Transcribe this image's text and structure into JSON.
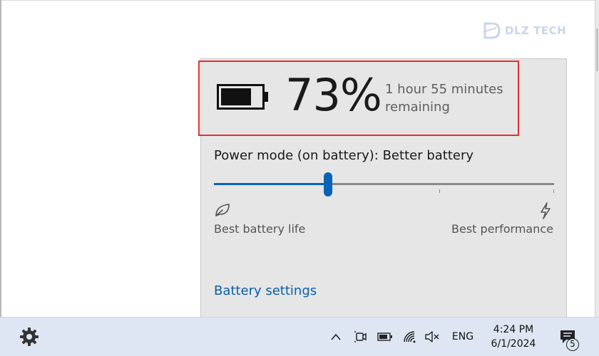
{
  "watermark": {
    "text": "DLZ TECH"
  },
  "battery_flyout": {
    "percent": "73%",
    "remaining_line1": "1 hour 55 minutes",
    "remaining_line2": "remaining",
    "power_mode_label": "Power mode (on battery): Better battery",
    "slider": {
      "value_fraction": 0.335,
      "tick_fractions": [
        0.665,
        1.0
      ]
    },
    "left_label": "Best battery life",
    "right_label": "Best performance",
    "settings_link": "Battery settings",
    "accent_color": "#0a64b6",
    "highlight_color": "#e03131"
  },
  "taskbar": {
    "language": "ENG",
    "time": "4:24 PM",
    "date": "6/1/2024",
    "notification_count": "5",
    "icons": [
      "gear-icon",
      "chevron-up-icon",
      "meet-now-icon",
      "battery-icon",
      "wifi-icon",
      "volume-muted-icon",
      "notification-icon"
    ]
  }
}
